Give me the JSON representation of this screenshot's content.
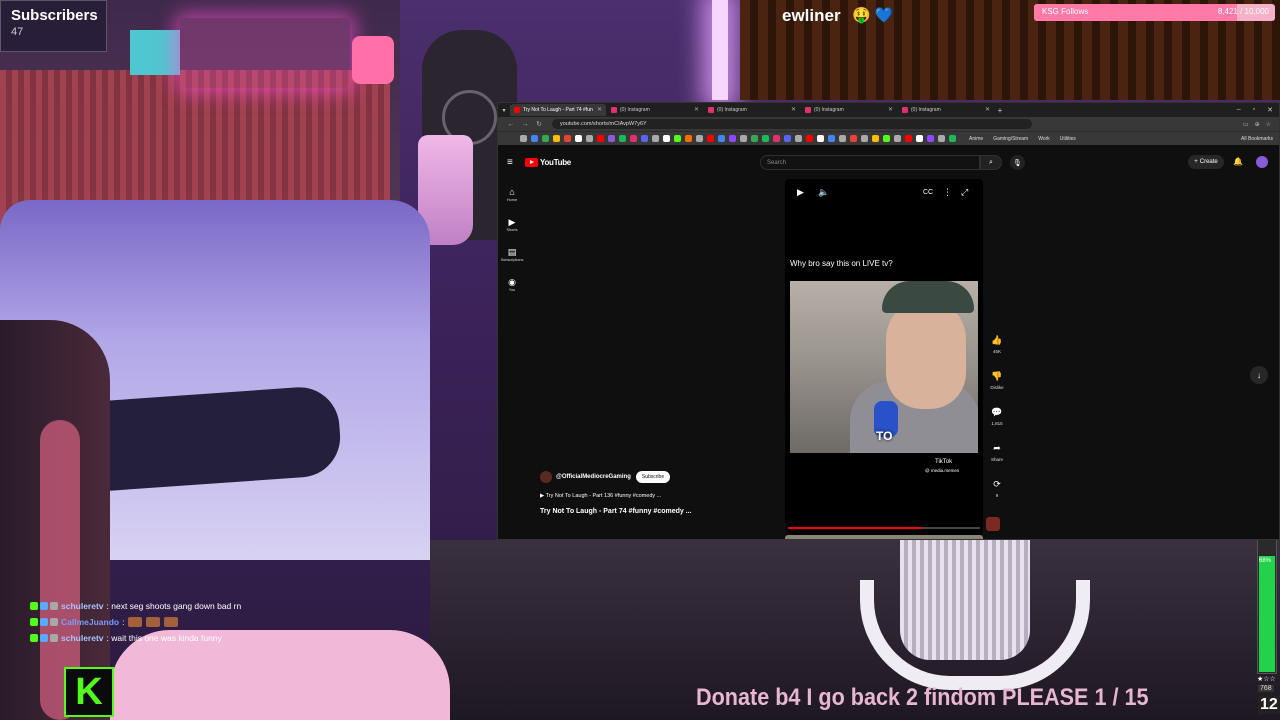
{
  "overlay": {
    "subscribers_title": "Subscribers",
    "subscribers_count": "47",
    "marquee_name": "ewliner",
    "marquee_emoji": "🤑 💙",
    "goal": {
      "label": "KSG Follows",
      "value": "8,421 / 10,000",
      "progress": 0.842
    },
    "donate_text": "Donate b4 I go back 2 findom PLEASE  1 / 15",
    "kick_logo": "K",
    "meter": {
      "label": "68%",
      "level": 0.68,
      "stars": "★☆☆",
      "num_small": "768",
      "num_big": "12"
    }
  },
  "chat": [
    {
      "user": "schuleretv",
      "message": ": next seg shoots gang down bad rn",
      "emotes": 0,
      "alt": false
    },
    {
      "user": "CallmeJuando",
      "message": ":",
      "emotes": 3,
      "alt": true
    },
    {
      "user": "schuleretv",
      "message": ": wait this one was kinda funny",
      "emotes": 0,
      "alt": false
    }
  ],
  "browser": {
    "tabs": [
      {
        "label": "Try Not To Laugh - Part 74 #fun",
        "type": "yt",
        "active": true
      },
      {
        "label": "(0) Instagram",
        "type": "ig",
        "active": false
      },
      {
        "label": "(0) Instagram",
        "type": "ig",
        "active": false
      },
      {
        "label": "(0) Instagram",
        "type": "ig",
        "active": false
      },
      {
        "label": "(0) Instagram",
        "type": "ig",
        "active": false
      }
    ],
    "url": "youtube.com/shorts/mCIAvpW7y6Y",
    "bookmark_folders": [
      "Anime",
      "Gaming/Stream",
      "Work",
      "Utilities"
    ],
    "all_bookmarks": "All Bookmarks"
  },
  "youtube": {
    "logo_text": "YouTube",
    "search_placeholder": "Search",
    "create_label": "Create",
    "sidebar": [
      {
        "icon": "⌂",
        "label": "Home",
        "name": "home"
      },
      {
        "icon": "▶",
        "label": "Shorts",
        "name": "shorts"
      },
      {
        "icon": "▤",
        "label": "Subscriptions",
        "name": "subscriptions"
      },
      {
        "icon": "◉",
        "label": "You",
        "name": "you"
      }
    ],
    "short": {
      "caption": "Why bro say this on LIVE tv?",
      "video_word": "TO",
      "watermark": "TikTok",
      "watermark_handle": "@ media.memes",
      "progress": 0.7
    },
    "channel_name": "@OfficialMediocreGaming",
    "subscribe_label": "Subscribe",
    "playlist_link": "Try Not To Laugh - Part 136 #funny #comedy ...",
    "video_title": "Try Not To Laugh - Part 74 #funny #comedy ...",
    "actions": [
      {
        "icon": "👍",
        "label": "45K",
        "name": "like"
      },
      {
        "icon": "👎",
        "label": "Dislike",
        "name": "dislike"
      },
      {
        "icon": "💬",
        "label": "1,815",
        "name": "comments"
      },
      {
        "icon": "➦",
        "label": "Share",
        "name": "share"
      },
      {
        "icon": "⟳",
        "label": "9",
        "name": "remix"
      }
    ]
  }
}
